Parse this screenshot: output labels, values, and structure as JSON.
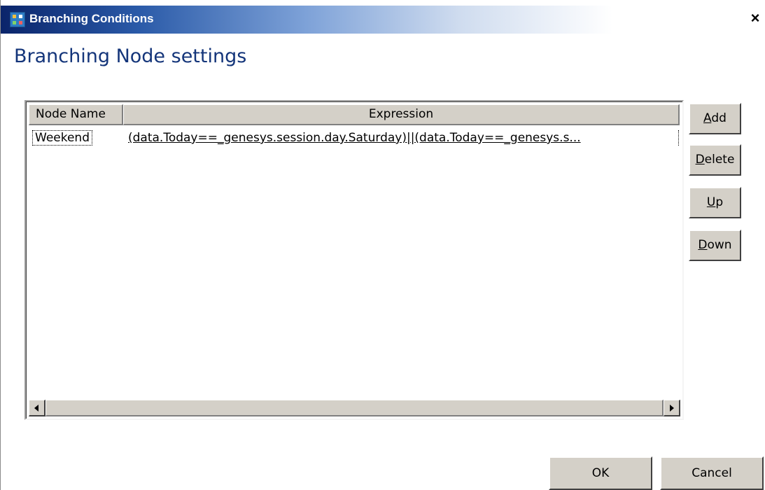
{
  "window": {
    "title": "Branching Conditions",
    "close_glyph": "×",
    "icon": "app-flowchart-icon"
  },
  "heading": "Branching Node settings",
  "table": {
    "columns": [
      "Node Name",
      "Expression"
    ],
    "rows": [
      {
        "node_name": "Weekend",
        "expression": "(data.Today==_genesys.session.day.Saturday)||(data.Today==_genesys.s..."
      }
    ]
  },
  "side_buttons": [
    {
      "mnemonic": "A",
      "rest": "dd"
    },
    {
      "mnemonic": "D",
      "rest": "elete"
    },
    {
      "mnemonic": "U",
      "rest": "p"
    },
    {
      "mnemonic": "D",
      "rest": "own"
    }
  ],
  "footer": {
    "ok_label": "OK",
    "cancel_label": "Cancel"
  },
  "scrollbar": {
    "left_icon": "scroll-left-arrow-icon",
    "right_icon": "scroll-right-arrow-icon"
  },
  "colors": {
    "title_gradient_start": "#0a246a",
    "heading": "#14357a",
    "button_face": "#d4d0c8"
  }
}
